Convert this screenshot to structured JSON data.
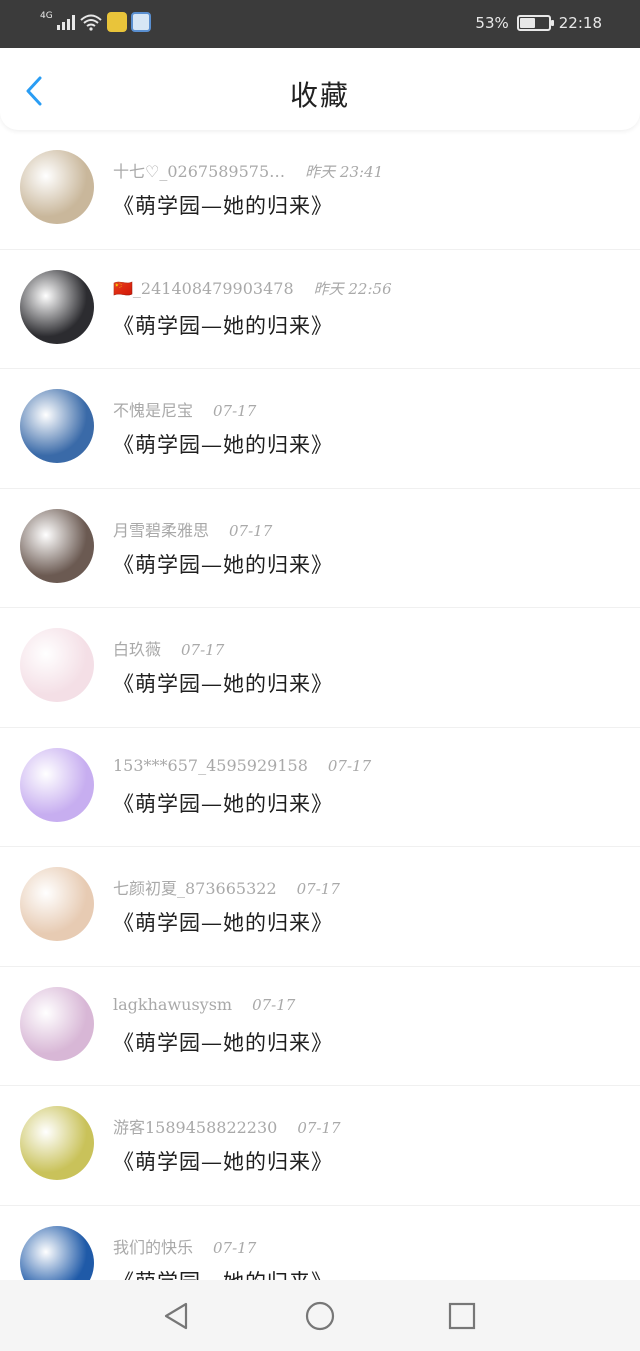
{
  "status_bar": {
    "network": "4G",
    "battery": "53%",
    "battery_level": 0.53,
    "time": "22:18"
  },
  "header": {
    "title": "收藏",
    "back_icon": "chevron-left-icon",
    "accent_color": "#2a9df4"
  },
  "favorites": [
    {
      "user": "十七♡_0267589575…",
      "time": "昨天  23:41",
      "title": "《萌学园—她的归来》",
      "avatar_color": "#c9b79b"
    },
    {
      "user": "🇨🇳_241408479903478",
      "time": "昨天  22:56",
      "title": "《萌学园—她的归来》",
      "avatar_color": "#2c2c30"
    },
    {
      "user": "不愧是尼宝",
      "time": "07-17",
      "title": "《萌学园—她的归来》",
      "avatar_color": "#3a6aa8"
    },
    {
      "user": "月雪碧柔雅思",
      "time": "07-17",
      "title": "《萌学园—她的归来》",
      "avatar_color": "#6b5a52"
    },
    {
      "user": "白玖薇",
      "time": "07-17",
      "title": "《萌学园—她的归来》",
      "avatar_color": "#f4dfe6"
    },
    {
      "user": "153***657_4595929158",
      "time": "07-17",
      "title": "《萌学园—她的归来》",
      "avatar_color": "#c7aef0"
    },
    {
      "user": "七颜初夏_873665322",
      "time": "07-17",
      "title": "《萌学园—她的归来》",
      "avatar_color": "#e7cbb3"
    },
    {
      "user": "lagkhawusysm",
      "time": "07-17",
      "title": "《萌学园—她的归来》",
      "avatar_color": "#d8b7d6"
    },
    {
      "user": "游客1589458822230",
      "time": "07-17",
      "title": "《萌学园—她的归来》",
      "avatar_color": "#c9c25a"
    },
    {
      "user": "我们的快乐",
      "time": "07-17",
      "title": "《萌学园—她的归来》",
      "avatar_color": "#1f5aa8"
    }
  ],
  "nav_bar": {
    "back_icon": "triangle-back-icon",
    "home_icon": "circle-home-icon",
    "recents_icon": "square-recents-icon"
  }
}
